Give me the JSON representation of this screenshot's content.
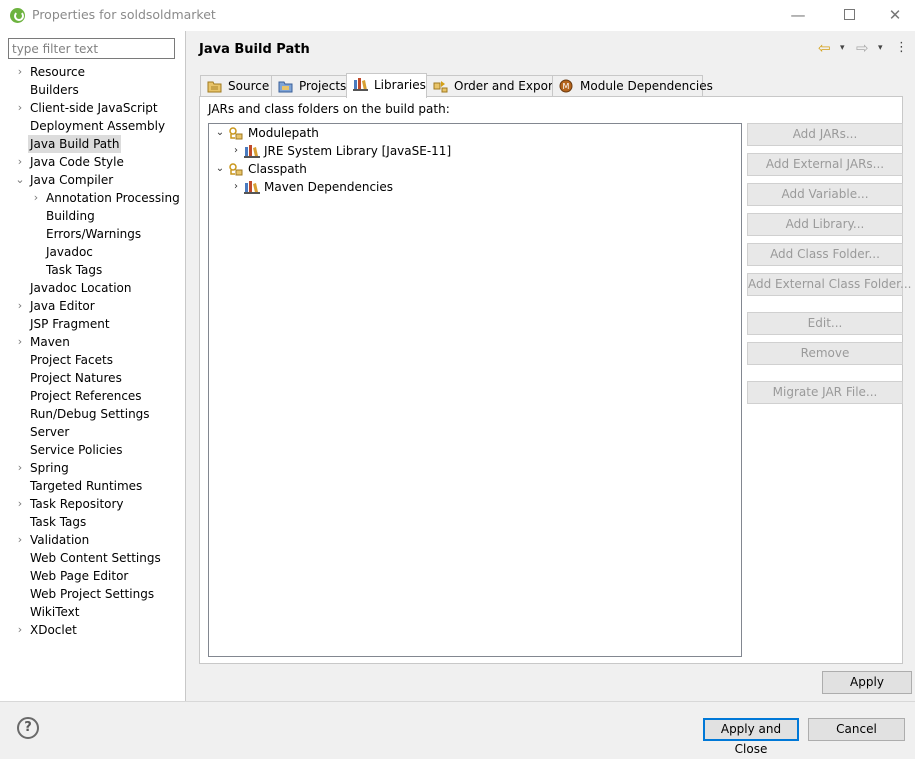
{
  "window": {
    "title": "Properties for soldsoldmarket",
    "controls": {
      "minimize": "—",
      "close": "✕"
    }
  },
  "filter": {
    "placeholder": "type filter text",
    "value": ""
  },
  "nav_tree": [
    {
      "label": "Resource",
      "expander": "›"
    },
    {
      "label": "Builders"
    },
    {
      "label": "Client-side JavaScript",
      "expander": "›"
    },
    {
      "label": "Deployment Assembly"
    },
    {
      "label": "Java Build Path",
      "selected": true
    },
    {
      "label": "Java Code Style",
      "expander": "›"
    },
    {
      "label": "Java Compiler",
      "expander": "⌄"
    },
    {
      "label": "Annotation Processing",
      "expander": "›",
      "child": true
    },
    {
      "label": "Building",
      "child": true
    },
    {
      "label": "Errors/Warnings",
      "child": true
    },
    {
      "label": "Javadoc",
      "child": true
    },
    {
      "label": "Task Tags",
      "child": true
    },
    {
      "label": "Javadoc Location"
    },
    {
      "label": "Java Editor",
      "expander": "›"
    },
    {
      "label": "JSP Fragment"
    },
    {
      "label": "Maven",
      "expander": "›"
    },
    {
      "label": "Project Facets"
    },
    {
      "label": "Project Natures"
    },
    {
      "label": "Project References"
    },
    {
      "label": "Run/Debug Settings"
    },
    {
      "label": "Server"
    },
    {
      "label": "Service Policies"
    },
    {
      "label": "Spring",
      "expander": "›"
    },
    {
      "label": "Targeted Runtimes"
    },
    {
      "label": "Task Repository",
      "expander": "›"
    },
    {
      "label": "Task Tags"
    },
    {
      "label": "Validation",
      "expander": "›"
    },
    {
      "label": "Web Content Settings"
    },
    {
      "label": "Web Page Editor"
    },
    {
      "label": "Web Project Settings"
    },
    {
      "label": "WikiText"
    },
    {
      "label": "XDoclet",
      "expander": "›"
    }
  ],
  "page": {
    "title": "Java Build Path",
    "nav": {
      "back": "⇦",
      "forward": "⇨",
      "dropdown": "▾",
      "menu": "⋮"
    }
  },
  "tabs": [
    {
      "label": "Source",
      "icon": "source-folder-icon"
    },
    {
      "label": "Projects",
      "icon": "projects-icon"
    },
    {
      "label": "Libraries",
      "icon": "libraries-icon",
      "active": true
    },
    {
      "label": "Order and Export",
      "icon": "order-export-icon"
    },
    {
      "label": "Module Dependencies",
      "icon": "module-icon"
    }
  ],
  "libraries": {
    "caption": "JARs and class folders on the build path:",
    "tree": [
      {
        "label": "Modulepath",
        "expander": "⌄",
        "icon": "path-container-icon"
      },
      {
        "label": "JRE System Library [JavaSE-11]",
        "expander": "›",
        "icon": "library-icon"
      },
      {
        "label": "Classpath",
        "expander": "⌄",
        "icon": "path-container-icon"
      },
      {
        "label": "Maven Dependencies",
        "expander": "›",
        "icon": "library-icon"
      }
    ],
    "buttons": [
      "Add JARs...",
      "Add External JARs...",
      "Add Variable...",
      "Add Library...",
      "Add Class Folder...",
      "Add External Class Folder...",
      "Edit...",
      "Remove",
      "Migrate JAR File..."
    ]
  },
  "apply_label": "Apply",
  "footer": {
    "help": "?",
    "apply_and_close": "Apply and Close",
    "cancel": "Cancel"
  },
  "colors": {
    "selection": "#dcdcdc",
    "default_button_border": "#0078d7",
    "disabled_text": "#9a9a9a",
    "spring_green": "#6db33f"
  }
}
